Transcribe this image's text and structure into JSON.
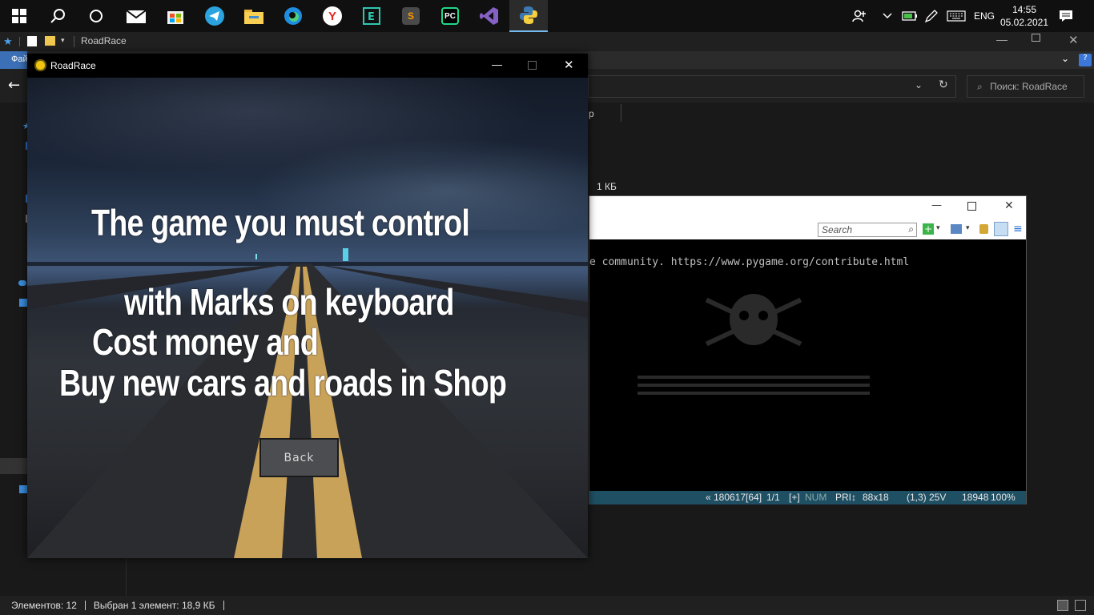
{
  "taskbar": {
    "icons": [
      "windows-start",
      "search",
      "cortana",
      "mail",
      "store",
      "telegram",
      "file-explorer",
      "edge",
      "yandex-browser",
      "e-app",
      "sublime-text",
      "pycharm",
      "visual-studio",
      "python"
    ],
    "language": "ENG",
    "time": "14:55",
    "date": "05.02.2021"
  },
  "explorer": {
    "title": "RoadRace",
    "menu_file": "Фай",
    "search_placeholder": "Поиск: RoadRace",
    "partial_tab": "р",
    "file_size": "1 КБ",
    "status_items": "Элементов: 12",
    "status_selected": "Выбран 1 элемент: 18,9 КБ"
  },
  "far": {
    "search_placeholder": "Search",
    "console_line": "e community. https://www.pygame.org/contribute.html",
    "status": {
      "pos": "« 180617[64]",
      "page": "1/1",
      "plus": "[+]",
      "num": "NUM",
      "pri": "PRI↕",
      "size": "88x18",
      "cursor": "(1,3) 25V",
      "pid": "18948",
      "zoom": "100%"
    }
  },
  "game": {
    "title": "RoadRace",
    "lines": [
      "The game you must control",
      "with Marks on keyboard",
      "Cost money and",
      "Buy new cars and roads in Shop"
    ],
    "back_label": "Back"
  }
}
